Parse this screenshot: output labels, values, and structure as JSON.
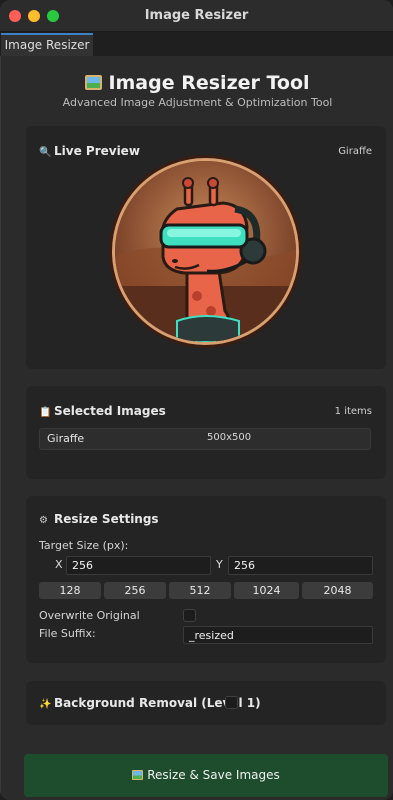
{
  "window": {
    "title": "Image Resizer"
  },
  "tab": {
    "label": "Image Resizer"
  },
  "header": {
    "title": "Image Resizer Tool",
    "subtitle": "Advanced Image Adjustment & Optimization Tool"
  },
  "preview": {
    "heading": "Live Preview",
    "image_name": "Giraffe"
  },
  "selected": {
    "heading": "Selected Images",
    "count": "1 items",
    "items": [
      {
        "name": "Giraffe",
        "size": "500x500"
      }
    ]
  },
  "resize": {
    "heading": "Resize Settings",
    "target_label": "Target Size (px):",
    "x_label": "X",
    "y_label": "Y",
    "x_value": "256",
    "y_value": "256",
    "presets": [
      "128",
      "256",
      "512",
      "1024",
      "2048"
    ],
    "overwrite_label": "Overwrite Original",
    "overwrite_checked": false,
    "suffix_label": "File Suffix:",
    "suffix_value": "_resized"
  },
  "background": {
    "label": "Background Removal (Level 1)",
    "checked": false
  },
  "action": {
    "label": "Resize & Save Images"
  },
  "icons": {
    "preview": "magnifier-icon",
    "selected": "clipboard-icon",
    "resize": "gear-icon",
    "background": "sparkles-icon",
    "action": "picture-icon"
  },
  "colors": {
    "action_bg": "#1e4d2e",
    "tab_accent": "#3b82c4",
    "close": "#fe5f57",
    "minimize": "#febc2e",
    "maximize": "#28c840"
  }
}
